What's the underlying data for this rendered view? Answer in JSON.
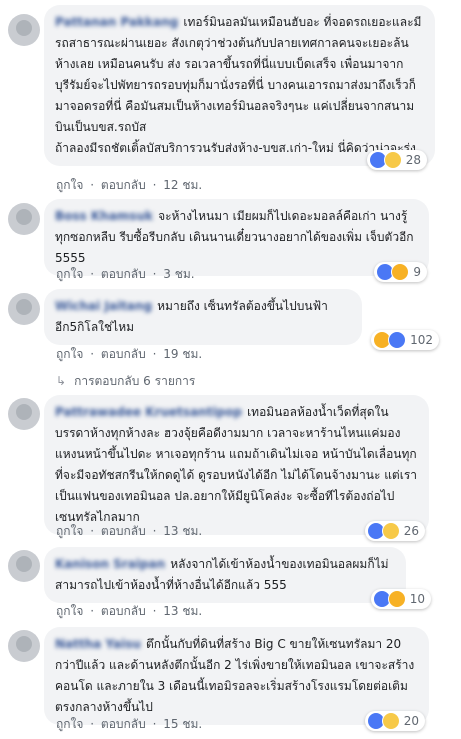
{
  "like_label": "ถูกใจ",
  "reply_label": "ตอบกลับ",
  "sep": "·",
  "replies_link": "การตอบกลับ 6 รายการ",
  "comments": [
    {
      "name": "Pattanan Pakkang",
      "text": "เทอร์มินอลมันเหมือนฮับอะ ที่จอดรถเยอะและมีรถสาธารณะผ่านเยอะ สังเกตุว่าช่วงต้นกับปลายเทศกาลคนจะเยอะล้นห้างเลย เหมือนคนรับ ส่ง รอเวลาขึ้นรถที่นี่แบบเบ็ดเสร็จ เพื่อนมาจากบุรีรัมย์จะไปพัทยารถรอบทุ่มก็มานั่งรอที่นี่ บางคนเอารถมาส่งมาถึงเร็วก็มาจอดรอที่นี่ คือมันสมเป็นห้างเทอร์มินอลจริงๆนะ แค่เปลี่ยนจากสนามบินเป็นบขส.รถบัส\nถ้าลองมีรถชัตเติ้ลบัสบริการวนรับส่งห้าง-บขส.เก่า-ใหม่ นี่คิดว่าน่าจะรุ่ง",
      "reactions": "28",
      "time": "12 ชม."
    },
    {
      "name": "Boss Khamsuk",
      "text": "จะห้างไหนมา เมียผมก็ไปเดอะมอลล์คือเก่า นางรู้ทุกซอกหลืบ รีบซื้อรีบกลับ เดินนานเดี๋ยวนางอยากได้ของเพิ่ม เจ็บตัวอีก 5555",
      "reactions": "9",
      "time": "3 ชม."
    },
    {
      "name": "Wichai Jaitang",
      "text": "หมายถึง เซ็นทรัลต้องขึ้นไปบนฟ้า อีก5กิโลใช่ไหม",
      "reactions": "102",
      "time": "19 ชม."
    },
    {
      "name": "Pattrawadee Kruetsantipop",
      "text": "เทอมินอลห้องน้ำเว็ดที่สุดในบรรดาห้างทุกห้างละ ฮวงจุ้ยคือดีงามมาก เวลาจะหาร้านไหนแค่มองแหงนหน้าขึ้นไปดะ หาเจอทุกร้าน แถมถ้าเดินไม่เจอ หน้าบันไดเลื่อนทุกที่จะมีจอทัชสกรีนให้กดดูได้ ดูรอบหนังได้อีก ไม่ได้โดนจ้างมานะ แต่เราเป็นแฟนของเทอมินอล ปล.อยากให้มียูนิโคล่งะ จะซื้อทีไรต้องถ่อไปเซนทรัลไกลมาก",
      "reactions": "26",
      "time": "13 ชม."
    },
    {
      "name": "Kanison Sraipan",
      "text": "หลังจากได้เข้าห้องน้ำของเทอมินอลผมก็ไม่สามารถไปเข้าห้องน้ำที่ห้างอื่นได้อีกแล้ว 555",
      "reactions": "10",
      "time": "13 ชม."
    },
    {
      "name": "Nattha Yaisu",
      "text": "ตึกนั้นกับที่ดินที่สร้าง Big C ขายให้เซนทรัลมา 20 กว่าปีแล้ว และด้านหลังตึกนั้นอีก 2 ไร่เพิ่งขายให้เทอมินอล เขาจะสร้างคอนโด และภายใน 3 เดือนนี้เทอมิรอลจะเริ่มสร้างโรงแรมโดยต่อเติมตรงกลางห้างขึ้นไป",
      "reactions": "20",
      "time": "15 ชม."
    }
  ]
}
